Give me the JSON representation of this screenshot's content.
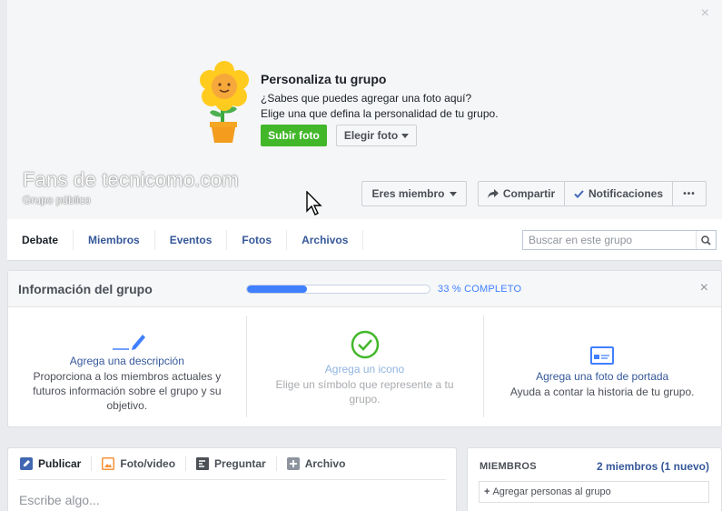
{
  "cover": {
    "close_symbol": "×",
    "customize_title": "Personaliza tu grupo",
    "customize_line1": "¿Sabes que puedes agregar una foto aquí?",
    "customize_line2": "Elige una que defina la personalidad de tu grupo.",
    "upload_label": "Subir foto",
    "choose_label": "Elegir foto",
    "group_name": "Fans de tecnicomo.com",
    "group_type": "Grupo público",
    "member_label": "Eres miembro",
    "share_label": "Compartir",
    "notifications_label": "Notificaciones",
    "more_label": "•••"
  },
  "nav": {
    "tabs": [
      "Debate",
      "Miembros",
      "Eventos",
      "Fotos",
      "Archivos"
    ],
    "search_placeholder": "Buscar en este grupo"
  },
  "info": {
    "title": "Información del grupo",
    "progress": 0.33,
    "progress_label": "33 % COMPLETO",
    "close_symbol": "×",
    "columns": [
      {
        "link": "Agrega una descripción",
        "desc": "Proporciona a los miembros actuales y futuros información sobre el grupo y su objetivo.",
        "icon": "pencil-icon"
      },
      {
        "link": "Agrega un icono",
        "desc": "Elige un símbolo que represente a tu grupo.",
        "icon": "check-circle-icon"
      },
      {
        "link": "Agrega una foto de portada",
        "desc": "Ayuda a contar la historia de tu grupo.",
        "icon": "cover-photo-icon"
      }
    ]
  },
  "composer": {
    "tabs": [
      "Publicar",
      "Foto/video",
      "Preguntar",
      "Archivo"
    ],
    "placeholder": "Escribe algo..."
  },
  "members": {
    "title": "MIEMBROS",
    "count": "2 miembros (1 nuevo)",
    "add_label": "Agregar personas al grupo"
  },
  "colors": {
    "link": "#365899",
    "green": "#42b72a",
    "progress": "#4080ff",
    "background": "#e9ebee"
  }
}
